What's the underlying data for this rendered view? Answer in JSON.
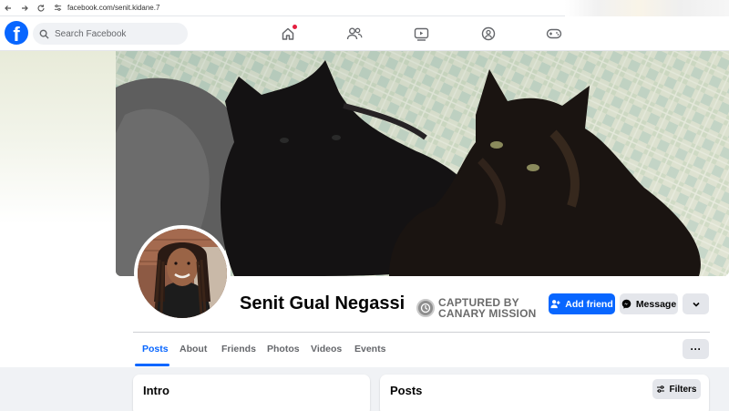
{
  "browser": {
    "url": "facebook.com/senit.kidane.7",
    "icons": [
      "back-icon",
      "forward-icon",
      "reload-icon",
      "site-settings-icon"
    ]
  },
  "fb_nav": {
    "logo": "f",
    "search_placeholder": "Search Facebook",
    "icons": [
      "home-icon",
      "friends-icon",
      "watch-icon",
      "groups-icon",
      "gaming-icon"
    ],
    "colors": {
      "brand": "#0866ff",
      "notification": "#e41e3f"
    }
  },
  "profile": {
    "name": "Senit Gual Negassi",
    "watermark_line1": "CAPTURED BY",
    "watermark_line2": "CANARY MISSION",
    "add_friend_label": "Add friend",
    "message_label": "Message"
  },
  "tabs": [
    {
      "label": "Posts",
      "active": true
    },
    {
      "label": "About",
      "active": false
    },
    {
      "label": "Friends",
      "active": false
    },
    {
      "label": "Photos",
      "active": false
    },
    {
      "label": "Videos",
      "active": false
    },
    {
      "label": "Events",
      "active": false
    }
  ],
  "more_label": "···",
  "intro": {
    "title": "Intro"
  },
  "posts": {
    "title": "Posts",
    "filters_label": "Filters"
  }
}
